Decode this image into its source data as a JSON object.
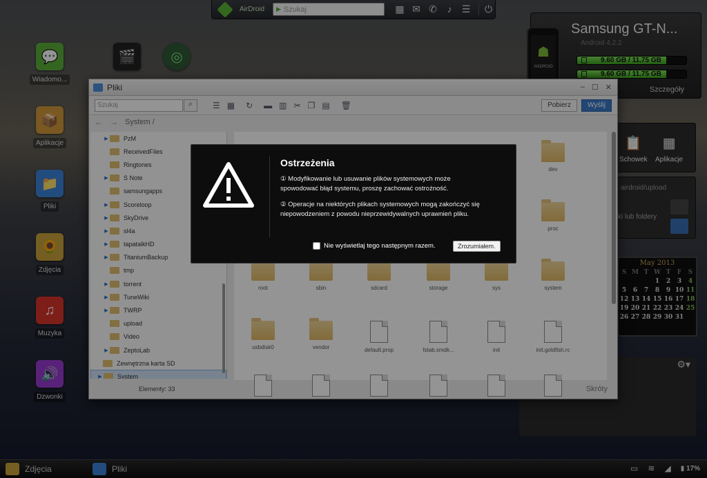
{
  "topbar": {
    "brand": "AirDroid",
    "search_placeholder": "Szukaj",
    "icons": [
      "apps-grid-icon",
      "mail-icon",
      "phone-icon",
      "bell-icon",
      "menu-icon"
    ],
    "power_icon": "power-icon"
  },
  "desktop": {
    "icons": [
      {
        "name": "messages",
        "label": "Wiadomo...",
        "color": "#5cb03a",
        "glyph": "💬"
      },
      {
        "name": "apps",
        "label": "Aplikacje",
        "color": "#d19a3a",
        "glyph": "📦"
      },
      {
        "name": "files",
        "label": "Pliki",
        "color": "#3c84d8",
        "glyph": "📁"
      },
      {
        "name": "photos",
        "label": "Zdjęcia",
        "color": "#c8a33a",
        "glyph": "🌻"
      },
      {
        "name": "music",
        "label": "Muzyka",
        "color": "#d9352b",
        "glyph": "♫"
      },
      {
        "name": "ringtones",
        "label": "Dzwonki",
        "color": "#9a3bd0",
        "glyph": "🔊"
      }
    ]
  },
  "device": {
    "name": "Samsung GT-N...",
    "os": "Android 4.2.2",
    "phone_label": "ANDROID",
    "storage": [
      {
        "label": "9.60 GB / 11.75 GB",
        "fraction": 0.817
      },
      {
        "label": "9.60 GB / 11.75 GB",
        "fraction": 0.817
      }
    ],
    "details": "Szczegóły"
  },
  "tools": {
    "clipboard": "Schowek",
    "apps": "Aplikacje"
  },
  "upload": {
    "path": "airdroid/upload",
    "hint": "ki lub foldery"
  },
  "calendar": {
    "month": "May 2013",
    "weekdays": [
      "S",
      "M",
      "T",
      "W",
      "T",
      "F",
      "S"
    ],
    "days": [
      "",
      "",
      "",
      "1",
      "2",
      "3",
      "4",
      "5",
      "6",
      "7",
      "8",
      "9",
      "10",
      "11",
      "12",
      "13",
      "14",
      "15",
      "16",
      "17",
      "18",
      "19",
      "20",
      "21",
      "22",
      "23",
      "24",
      "25",
      "26",
      "27",
      "28",
      "29",
      "30",
      "31",
      ""
    ]
  },
  "files_window": {
    "title": "Pliki",
    "search_placeholder": "Szukaj",
    "download_label": "Pobierz",
    "send_label": "Wyślij",
    "path": "System /",
    "tree": [
      {
        "label": "PzM",
        "expandable": true
      },
      {
        "label": "ReceivedFiles",
        "expandable": false
      },
      {
        "label": "Ringtones",
        "expandable": false
      },
      {
        "label": "S Note",
        "expandable": true
      },
      {
        "label": "samsungapps",
        "expandable": false
      },
      {
        "label": "Scoreloop",
        "expandable": true
      },
      {
        "label": "SkyDrive",
        "expandable": true
      },
      {
        "label": "sl4a",
        "expandable": true
      },
      {
        "label": "tapatalkHD",
        "expandable": true
      },
      {
        "label": "TitaniumBackup",
        "expandable": true
      },
      {
        "label": "tmp",
        "expandable": false
      },
      {
        "label": "torrent",
        "expandable": true
      },
      {
        "label": "TuneWiki",
        "expandable": true
      },
      {
        "label": "TWRP",
        "expandable": true
      },
      {
        "label": "upload",
        "expandable": false
      },
      {
        "label": "Video",
        "expandable": false
      },
      {
        "label": "ZeptoLab",
        "expandable": true
      },
      {
        "label": "Zewnętrzna karta SD",
        "expandable": false
      },
      {
        "label": "System",
        "expandable": true,
        "selected": true
      }
    ],
    "grid_items": [
      {
        "label": "dev",
        "kind": "folder"
      },
      {
        "label": "proc",
        "kind": "folder"
      },
      {
        "label": "root",
        "kind": "folder"
      },
      {
        "label": "sbin",
        "kind": "folder"
      },
      {
        "label": "sdcard",
        "kind": "folder"
      },
      {
        "label": "storage",
        "kind": "folder"
      },
      {
        "label": "sys",
        "kind": "folder"
      },
      {
        "label": "system",
        "kind": "folder"
      },
      {
        "label": "usbdisk0",
        "kind": "folder"
      },
      {
        "label": "vendor",
        "kind": "folder"
      },
      {
        "label": "default.prop",
        "kind": "file"
      },
      {
        "label": "fstab.smdk...",
        "kind": "file"
      },
      {
        "label": "init",
        "kind": "file"
      },
      {
        "label": "init.goldfish.rc",
        "kind": "file"
      }
    ],
    "status_count": "Elementy: 33",
    "shortcuts": "Skróty"
  },
  "dialog": {
    "title": "Ostrzeżenia",
    "para1": "① Modyfikowanie lub usuwanie plików systemowych może spowodować błąd systemu, proszę zachować ostrożność.",
    "para2": "② Operacje na niektórych plikach systemowych mogą zakończyć się niepowodzeniem z powodu nieprzewidywalnych uprawnień pliku.",
    "checkbox_label": "Nie wyświetlaj tego następnym razem.",
    "ok_label": "Zrozumiałem."
  },
  "taskbar": {
    "tasks": [
      {
        "label": "Zdjęcia",
        "color": "#c8a33a"
      },
      {
        "label": "Pliki",
        "color": "#3c84d8"
      }
    ],
    "battery": "17%"
  }
}
